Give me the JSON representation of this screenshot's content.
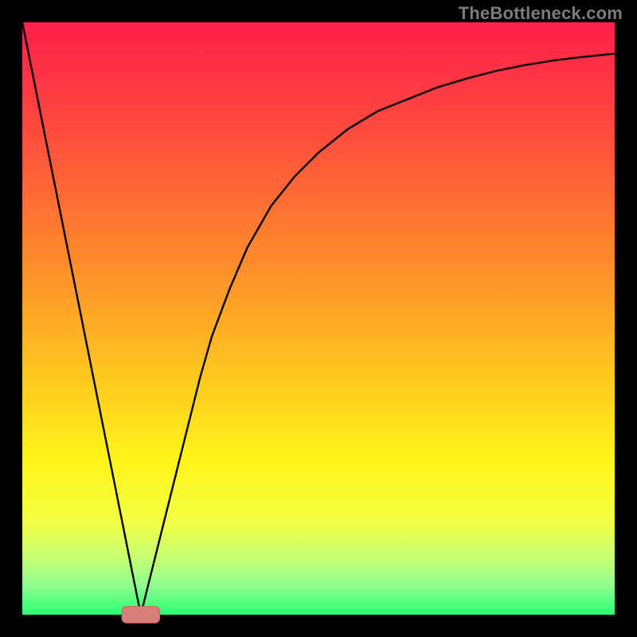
{
  "watermark": "TheBottleneck.com",
  "colors": {
    "border": "#000000",
    "curve": "#000000",
    "marker_fill": "#d77d7a",
    "marker_stroke": "#c96863",
    "gradient_stops": [
      {
        "offset": 0.0,
        "color": "#ff1f4a"
      },
      {
        "offset": 0.18,
        "color": "#ff4a3e"
      },
      {
        "offset": 0.4,
        "color": "#ff8a2a"
      },
      {
        "offset": 0.6,
        "color": "#ffc81f"
      },
      {
        "offset": 0.74,
        "color": "#fff41a"
      },
      {
        "offset": 0.84,
        "color": "#f3ff41"
      },
      {
        "offset": 0.9,
        "color": "#c9ff70"
      },
      {
        "offset": 0.95,
        "color": "#8fff8f"
      },
      {
        "offset": 1.0,
        "color": "#2aff74"
      }
    ]
  },
  "chart_data": {
    "type": "line",
    "title": "",
    "xlabel": "",
    "ylabel": "",
    "xlim": [
      0,
      100
    ],
    "ylim": [
      0,
      100
    ],
    "x": [
      0,
      2,
      4,
      6,
      8,
      10,
      12,
      14,
      16,
      18,
      19,
      20,
      21,
      22,
      24,
      26,
      28,
      30,
      32,
      35,
      38,
      42,
      46,
      50,
      55,
      60,
      65,
      70,
      75,
      80,
      85,
      90,
      95,
      100
    ],
    "values": [
      100,
      90,
      80,
      70,
      60,
      50,
      40,
      30,
      20,
      10,
      5,
      0,
      4,
      8,
      16,
      24,
      32,
      40,
      47,
      55,
      62,
      69,
      74,
      78,
      82,
      85,
      87,
      89,
      90.5,
      91.8,
      92.8,
      93.6,
      94.2,
      94.7
    ],
    "marker": {
      "x": 20,
      "y": 0,
      "rx": 3.2,
      "ry": 1.4
    }
  }
}
